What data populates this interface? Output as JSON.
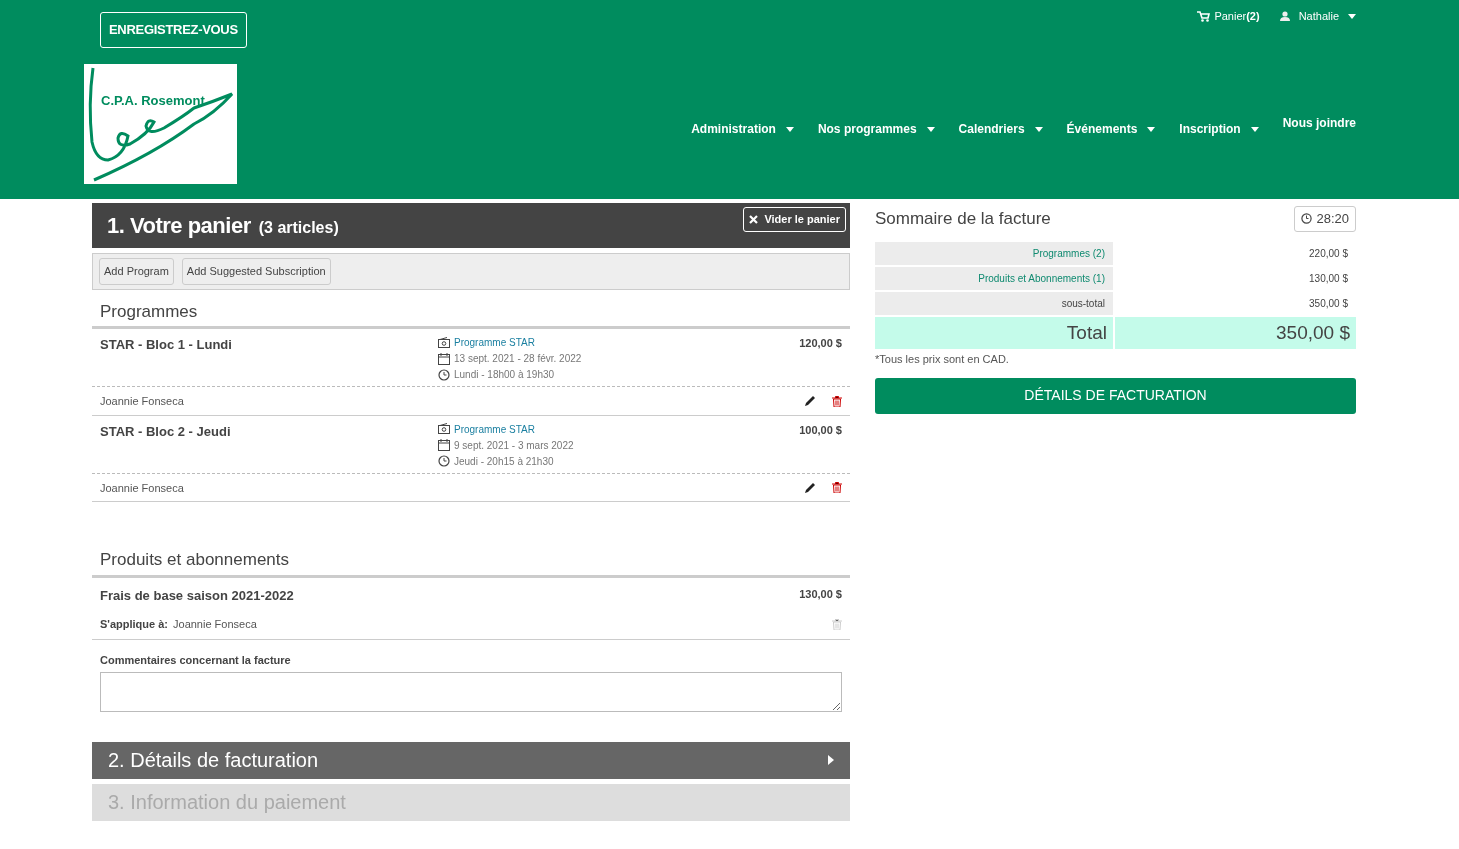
{
  "header": {
    "register_button": "ENREGISTREZ-VOUS",
    "logo_text": "C.P.A. Rosemont",
    "cart_link": {
      "label": "Panier",
      "count": "(2)"
    },
    "user_menu": "Nathalie",
    "nav": [
      {
        "label": "Administration",
        "dropdown": true
      },
      {
        "label": "Nos programmes",
        "dropdown": true
      },
      {
        "label": "Calendriers",
        "dropdown": true
      },
      {
        "label": "Événements",
        "dropdown": true
      },
      {
        "label": "Inscription",
        "dropdown": true
      },
      {
        "label": "Nous joindre",
        "dropdown": false
      }
    ]
  },
  "cart": {
    "title": "1. Votre panier",
    "count": "(3 articles)",
    "clear_button": "Vider le panier",
    "toolbar_buttons": [
      "Add Program",
      "Add Suggested Subscription"
    ],
    "programs_heading": "Programmes",
    "programs": [
      {
        "name": "STAR - Bloc 1 - Lundi",
        "program": "Programme STAR",
        "dates": "13 sept. 2021 - 28 févr. 2022",
        "schedule": "Lundi - 18h00 à 19h30",
        "price": "120,00 $",
        "participant": "Joannie Fonseca"
      },
      {
        "name": "STAR - Bloc 2 - Jeudi",
        "program": "Programme STAR",
        "dates": "9 sept. 2021 - 3 mars 2022",
        "schedule": "Jeudi - 20h15 à 21h30",
        "price": "100,00 $",
        "participant": "Joannie Fonseca"
      }
    ],
    "products_heading": "Produits et abonnements",
    "products": [
      {
        "name": "Frais de base saison 2021-2022",
        "price": "130,00 $",
        "applies_label": "S'applique à:",
        "participant": "Joannie Fonseca",
        "delete_disabled": true
      }
    ],
    "comments_label": "Commentaires concernant la facture"
  },
  "steps": [
    {
      "title": "2. Détails de facturation",
      "disabled": false
    },
    {
      "title": "3. Information du paiement",
      "disabled": true
    }
  ],
  "summary": {
    "title": "Sommaire de la facture",
    "timer": "28:20",
    "rows": [
      {
        "label": "Programmes (2)",
        "value": "220,00 $",
        "kind": "link"
      },
      {
        "label": "Produits et Abonnements (1)",
        "value": "130,00 $",
        "kind": "link"
      },
      {
        "label": "sous-total",
        "value": "350,00 $",
        "kind": "plain"
      },
      {
        "label": "Total",
        "value": "350,00 $",
        "kind": "total"
      }
    ],
    "note": "*Tous les prix sont en CAD.",
    "button": "DÉTAILS DE FACTURATION"
  }
}
